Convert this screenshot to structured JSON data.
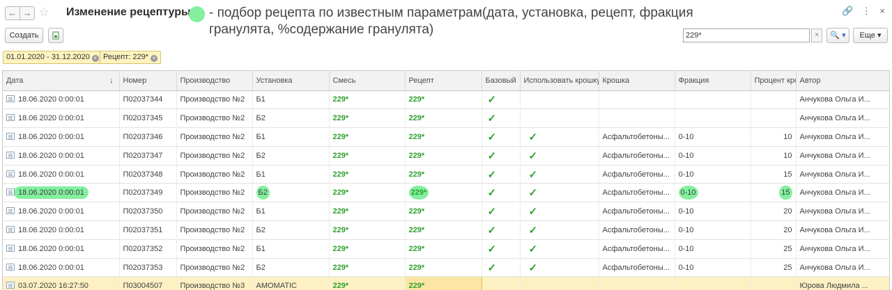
{
  "header": {
    "title": "Изменение рецептуры",
    "annotation": "- подбор рецепта по известным параметрам(дата, установка, рецепт, фракция гранулята, %содержание гранулята)",
    "back_icon": "←",
    "forward_icon": "→",
    "star_icon": "☆",
    "link_icon": "🔗",
    "menu_icon": "⋮",
    "close_icon": "×"
  },
  "toolbar": {
    "create_label": "Создать",
    "search_value": "229*",
    "search_clear": "×",
    "find_label": "🔍 ▾",
    "more_label": "Еще ▾"
  },
  "filters": {
    "date": "01.01.2020 - 31.12.2020",
    "recipe": "Рецепт: 229*"
  },
  "table": {
    "columns": [
      "Дата",
      "Номер",
      "Производство",
      "Установка",
      "Смесь",
      "Рецепт",
      "Базовый",
      "Использовать крошку",
      "Крошка",
      "Фракция",
      "Процент крошки",
      "Автор"
    ],
    "sort_arrow": "↓",
    "rows": [
      {
        "date": "18.06.2020 0:00:01",
        "number": "П02037344",
        "production": "Производство №2",
        "unit": "Б1",
        "mix": "229*",
        "recipe": "229*",
        "base": "✓",
        "use_crumb": "",
        "crumb": "",
        "fraction": "",
        "percent": "",
        "author": "Анчукова Ольга И..."
      },
      {
        "date": "18.06.2020 0:00:01",
        "number": "П02037345",
        "production": "Производство №2",
        "unit": "Б2",
        "mix": "229*",
        "recipe": "229*",
        "base": "✓",
        "use_crumb": "",
        "crumb": "",
        "fraction": "",
        "percent": "",
        "author": "Анчукова Ольга И..."
      },
      {
        "date": "18.06.2020 0:00:01",
        "number": "П02037346",
        "production": "Производство №2",
        "unit": "Б1",
        "mix": "229*",
        "recipe": "229*",
        "base": "✓",
        "use_crumb": "✓",
        "crumb": "Асфальтобетоны...",
        "fraction": "0-10",
        "percent": "10",
        "author": "Анчукова Ольга И..."
      },
      {
        "date": "18.06.2020 0:00:01",
        "number": "П02037347",
        "production": "Производство №2",
        "unit": "Б2",
        "mix": "229*",
        "recipe": "229*",
        "base": "✓",
        "use_crumb": "✓",
        "crumb": "Асфальтобетоны...",
        "fraction": "0-10",
        "percent": "10",
        "author": "Анчукова Ольга И..."
      },
      {
        "date": "18.06.2020 0:00:01",
        "number": "П02037348",
        "production": "Производство №2",
        "unit": "Б1",
        "mix": "229*",
        "recipe": "229*",
        "base": "✓",
        "use_crumb": "✓",
        "crumb": "Асфальтобетоны...",
        "fraction": "0-10",
        "percent": "15",
        "author": "Анчукова Ольга И..."
      },
      {
        "date": "18.06.2020 0:00:01",
        "number": "П02037349",
        "production": "Производство №2",
        "unit": "Б2",
        "mix": "229*",
        "recipe": "229*",
        "base": "✓",
        "use_crumb": "✓",
        "crumb": "Асфальтобетоны...",
        "fraction": "0-10",
        "percent": "15",
        "author": "Анчукова Ольга И..."
      },
      {
        "date": "18.06.2020 0:00:01",
        "number": "П02037350",
        "production": "Производство №2",
        "unit": "Б1",
        "mix": "229*",
        "recipe": "229*",
        "base": "✓",
        "use_crumb": "✓",
        "crumb": "Асфальтобетоны...",
        "fraction": "0-10",
        "percent": "20",
        "author": "Анчукова Ольга И..."
      },
      {
        "date": "18.06.2020 0:00:01",
        "number": "П02037351",
        "production": "Производство №2",
        "unit": "Б2",
        "mix": "229*",
        "recipe": "229*",
        "base": "✓",
        "use_crumb": "✓",
        "crumb": "Асфальтобетоны...",
        "fraction": "0-10",
        "percent": "20",
        "author": "Анчукова Ольга И..."
      },
      {
        "date": "18.06.2020 0:00:01",
        "number": "П02037352",
        "production": "Производство №2",
        "unit": "Б1",
        "mix": "229*",
        "recipe": "229*",
        "base": "✓",
        "use_crumb": "✓",
        "crumb": "Асфальтобетоны...",
        "fraction": "0-10",
        "percent": "25",
        "author": "Анчукова Ольга И..."
      },
      {
        "date": "18.06.2020 0:00:01",
        "number": "П02037353",
        "production": "Производство №2",
        "unit": "Б2",
        "mix": "229*",
        "recipe": "229*",
        "base": "✓",
        "use_crumb": "✓",
        "crumb": "Асфальтобетоны...",
        "fraction": "0-10",
        "percent": "25",
        "author": "Анчукова Ольга И..."
      },
      {
        "date": "03.07.2020 16:27:50",
        "number": "П03004507",
        "production": "Производство №3",
        "unit": "AMOMATIC",
        "mix": "229*",
        "recipe": "229*",
        "base": "",
        "use_crumb": "",
        "crumb": "",
        "fraction": "",
        "percent": "",
        "author": "Юрова Людмила ..."
      }
    ]
  },
  "colors": {
    "highlight": "#83ef9f",
    "accent_green": "#2ea12e",
    "selection": "#fdf1c4"
  }
}
